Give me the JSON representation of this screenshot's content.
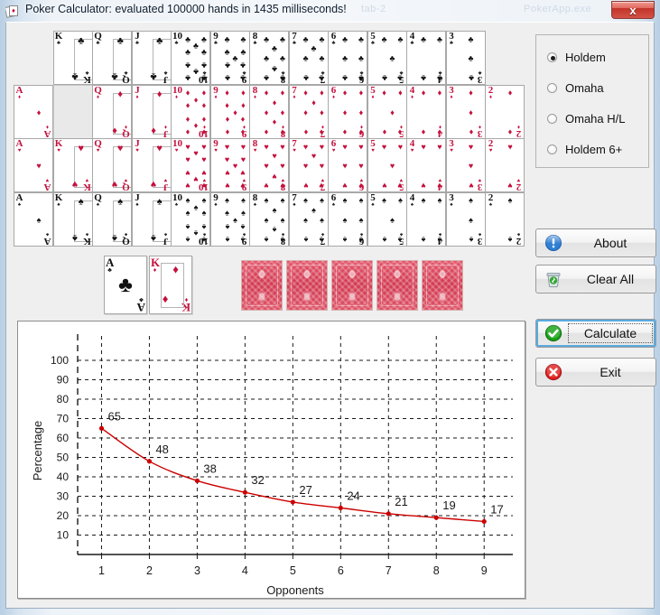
{
  "window": {
    "title": "Poker Calculator: evaluated 100000 hands in 1435 milliseconds!",
    "icon": "cards-icon",
    "close_label": "x",
    "ghost_text_1": "tab-2",
    "ghost_text_2": "PokerApp.exe"
  },
  "colors": {
    "red_suit": "#c4103c",
    "black_suit": "#111111",
    "card_back": "#d23b52",
    "chart_line": "#cc0000",
    "accent_focus": "#5aaade",
    "window_bg": "#efefef"
  },
  "card_grid": {
    "ranks": [
      "A",
      "K",
      "Q",
      "J",
      "10",
      "9",
      "8",
      "7",
      "6",
      "5",
      "4",
      "3",
      "2"
    ],
    "suits": [
      {
        "name": "clubs",
        "glyph": "♣",
        "color": "black"
      },
      {
        "name": "diamonds",
        "glyph": "♦",
        "color": "red"
      },
      {
        "name": "hearts",
        "glyph": "♥",
        "color": "red"
      },
      {
        "name": "spades",
        "glyph": "♠",
        "color": "black"
      }
    ],
    "selected_cards": [
      "A♣",
      "K♦"
    ]
  },
  "game_type": {
    "legend": "",
    "options": [
      {
        "label": "Holdem",
        "checked": true
      },
      {
        "label": "Omaha",
        "checked": false
      },
      {
        "label": "Omaha H/L",
        "checked": false
      },
      {
        "label": "Holdem 6+",
        "checked": false
      }
    ]
  },
  "hole_cards": [
    {
      "rank": "A",
      "suit": "♣",
      "color": "black"
    },
    {
      "rank": "K",
      "suit": "♦",
      "color": "red"
    }
  ],
  "board_cards": [
    {
      "face_down": true
    },
    {
      "face_down": true
    },
    {
      "face_down": true
    },
    {
      "face_down": true
    },
    {
      "face_down": true
    }
  ],
  "buttons": [
    {
      "label": "About",
      "icon": "info-icon",
      "focused": false
    },
    {
      "label": "Clear All",
      "icon": "trash-icon",
      "focused": false
    },
    {
      "label": "Calculate",
      "icon": "check-circle-icon",
      "focused": true
    },
    {
      "label": "Exit",
      "icon": "close-circle-icon",
      "focused": false
    }
  ],
  "chart_data": {
    "type": "line",
    "title": "",
    "xlabel": "Opponents",
    "ylabel": "Percentage",
    "categories": [
      1,
      2,
      3,
      4,
      5,
      6,
      7,
      8,
      9
    ],
    "values": [
      65,
      48,
      38,
      32,
      27,
      24,
      21,
      19,
      17
    ],
    "point_labels": [
      "65",
      "48",
      "38",
      "32",
      "27",
      "24",
      "21",
      "19",
      "17"
    ],
    "xticks": [
      "1",
      "2",
      "3",
      "4",
      "5",
      "6",
      "7",
      "8",
      "9"
    ],
    "yticks": [
      "10",
      "20",
      "30",
      "40",
      "50",
      "60",
      "70",
      "80",
      "90",
      "100"
    ],
    "xlim": [
      0.5,
      9.6
    ],
    "ylim": [
      0,
      107
    ],
    "grid": true,
    "grid_style": "dashed",
    "legend": "none",
    "line_color": "#cc0000",
    "marker": "circle"
  }
}
